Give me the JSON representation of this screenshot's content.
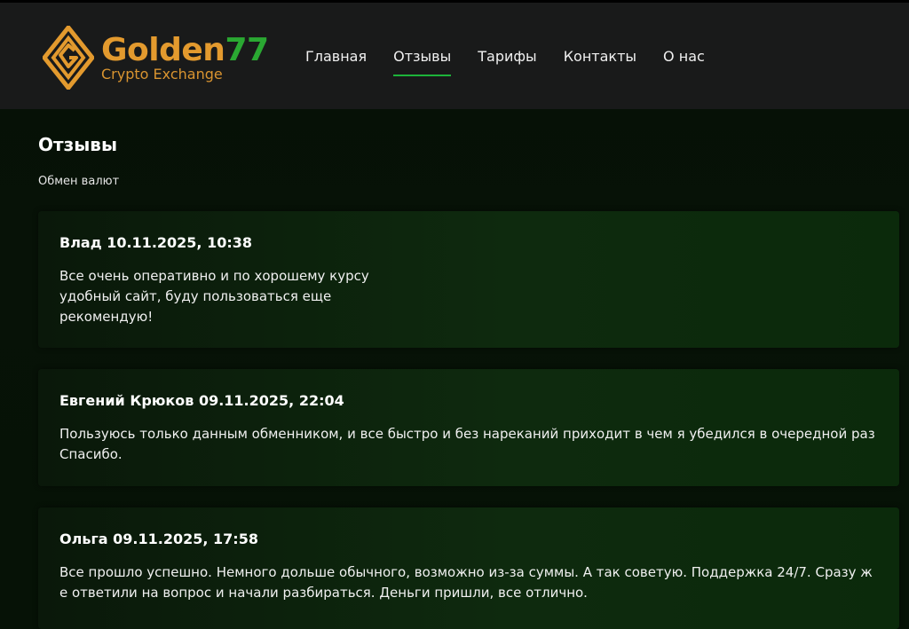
{
  "brand": {
    "name_part1": "Golden",
    "name_part2": "77",
    "tagline": "Crypto Exchange",
    "colors": {
      "gold": "#e39a2e",
      "green": "#2aa832"
    },
    "icon": "diamond-logo-icon"
  },
  "nav": {
    "items": [
      {
        "label": "Главная",
        "active": false
      },
      {
        "label": "Отзывы",
        "active": true
      },
      {
        "label": "Тарифы",
        "active": false
      },
      {
        "label": "Контакты",
        "active": false
      },
      {
        "label": "О нас",
        "active": false
      }
    ],
    "active_color": "#1db33a"
  },
  "page": {
    "title": "Отзывы",
    "subtitle": "Обмен валют"
  },
  "reviews": [
    {
      "author_date": "Влад 10.11.2025, 10:38",
      "text": "Все очень оперативно и по хорошему курсу удобный сайт, буду пользоваться еще рекомендую!"
    },
    {
      "author_date": "Евгений Крюков 09.11.2025, 22:04",
      "text": "Пользуюсь только данным обменником, и все быстро и без нареканий приходит в чем я убедился в очередной раз Спасибо."
    },
    {
      "author_date": "Ольга 09.11.2025, 17:58",
      "text": "Все прошло успешно. Немного дольше обычного, возможно из-за суммы. А так советую. Поддержка 24/7. Сразу ж е ответили на вопрос и начали разбираться. Деньги пришли, все отлично."
    }
  ]
}
